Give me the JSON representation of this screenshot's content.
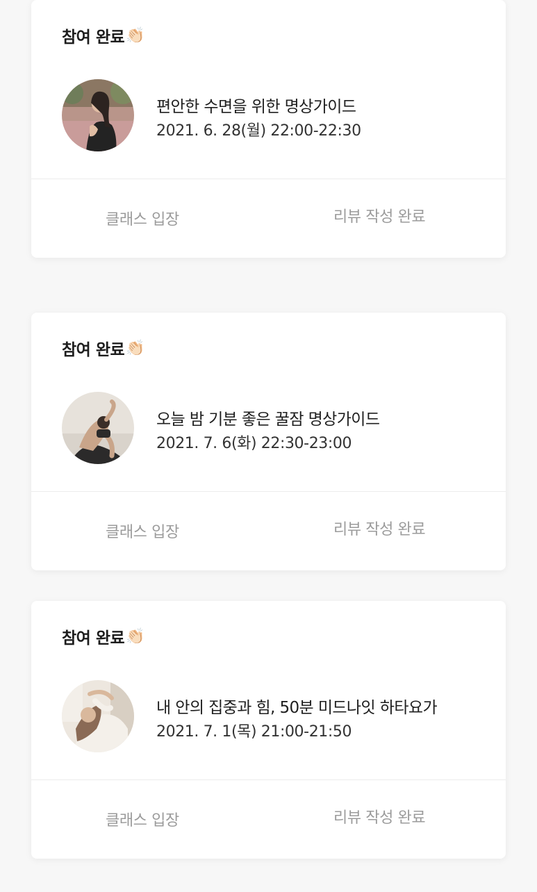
{
  "cards": [
    {
      "status": "참여 완료",
      "status_icon": "👏🏻",
      "title": "오늘 밤 기분 좋은 꿀잠 명상가이드",
      "datetime": "2021. 7. 6(화) 22:30-23:00",
      "enter_label": "클래스 입장",
      "review_label": "리뷰 작성 완료"
    },
    {
      "status": "참여 완료",
      "status_icon": "👏🏻",
      "title": "내 안의 집중과 힘, 50분 미드나잇 하타요가",
      "datetime": "2021. 7. 1(목) 21:00-21:50",
      "enter_label": "클래스 입장",
      "review_label": "리뷰 작성 완료"
    },
    {
      "status": "참여 완료",
      "status_icon": "👏🏻",
      "title": "편안한 수면을 위한 명상가이드",
      "datetime": "2021. 6. 28(월) 22:00-22:30",
      "enter_label": "클래스 입장",
      "review_label": "리뷰 작성 완료"
    }
  ],
  "colors": {
    "background": "#f7f7f7",
    "card": "#ffffff",
    "text_primary": "#1f1f1f",
    "text_muted": "#9b9b9b",
    "divider": "#ececec"
  }
}
